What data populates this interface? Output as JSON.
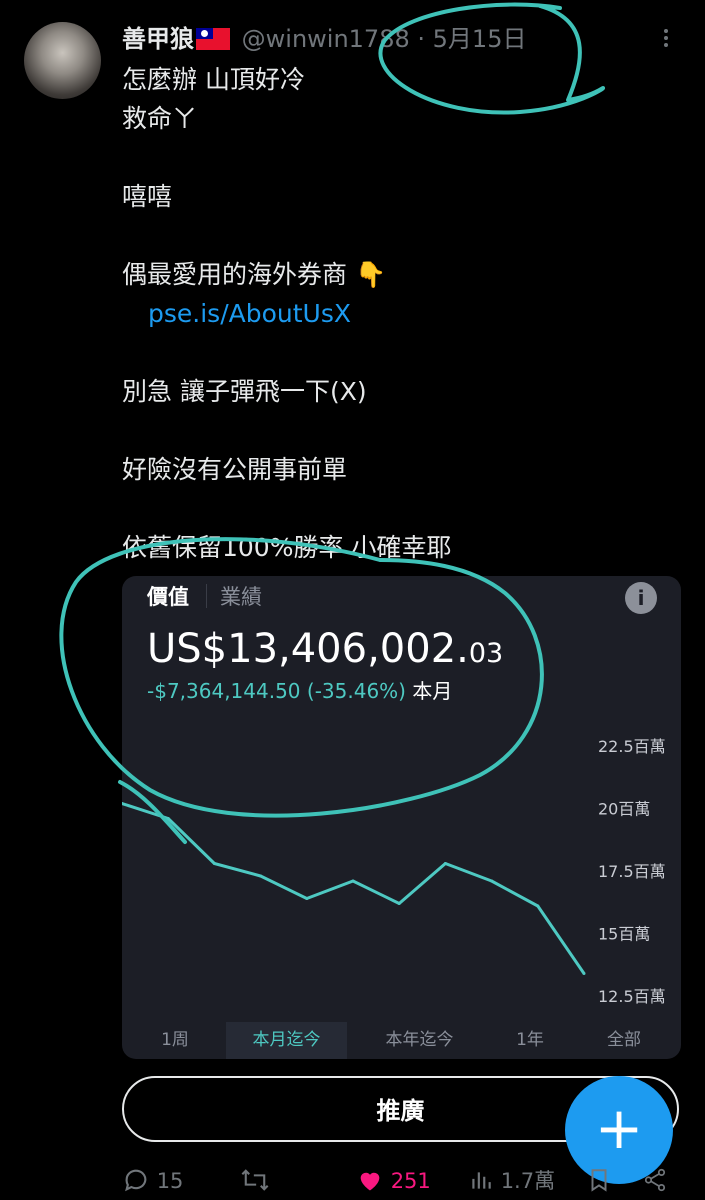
{
  "tweet": {
    "author_name": "善甲狼",
    "handle": "@winwin1788",
    "dot": "·",
    "date": "5月15日",
    "lines": [
      "怎麼辦 山頂好冷",
      "救命ㄚ",
      "",
      "嘻嘻",
      "",
      "偶最愛用的海外券商 👇",
      "",
      "",
      "別急 讓子彈飛一下(X)",
      "",
      "好險沒有公開事前單",
      "",
      "依舊保留100%勝率 小確幸耶"
    ],
    "link": "pse.is/AboutUsX"
  },
  "card": {
    "tab_value": "價值",
    "tab_performance": "業績",
    "info": "i",
    "value_main": "US$13,406,002.",
    "value_cents": "03",
    "change_amount": "-$7,364,144.50 (-35.46%)",
    "change_period": "本月",
    "ranges": [
      "1周",
      "本月迄今",
      "本年迄今",
      "1年",
      "全部"
    ],
    "active_range": "本月迄今"
  },
  "chart_data": {
    "type": "line",
    "y_ticks": [
      "22.5百萬",
      "20百萬",
      "17.5百萬",
      "15百萬",
      "12.5百萬"
    ],
    "ylim": [
      12500000,
      22500000
    ],
    "values": [
      20200000,
      19600000,
      17800000,
      17300000,
      16400000,
      17100000,
      16200000,
      17800000,
      17100000,
      16100000,
      13400000
    ],
    "color": "#4ec9c2"
  },
  "promote_label": "推廣",
  "fab_label": "+",
  "actions": {
    "replies": "15",
    "retweets": "",
    "likes": "251",
    "views": "1.7萬"
  },
  "colors": {
    "accent_blue": "#1d9bf0",
    "like_pink": "#f91880",
    "teal": "#4ec9c2"
  }
}
